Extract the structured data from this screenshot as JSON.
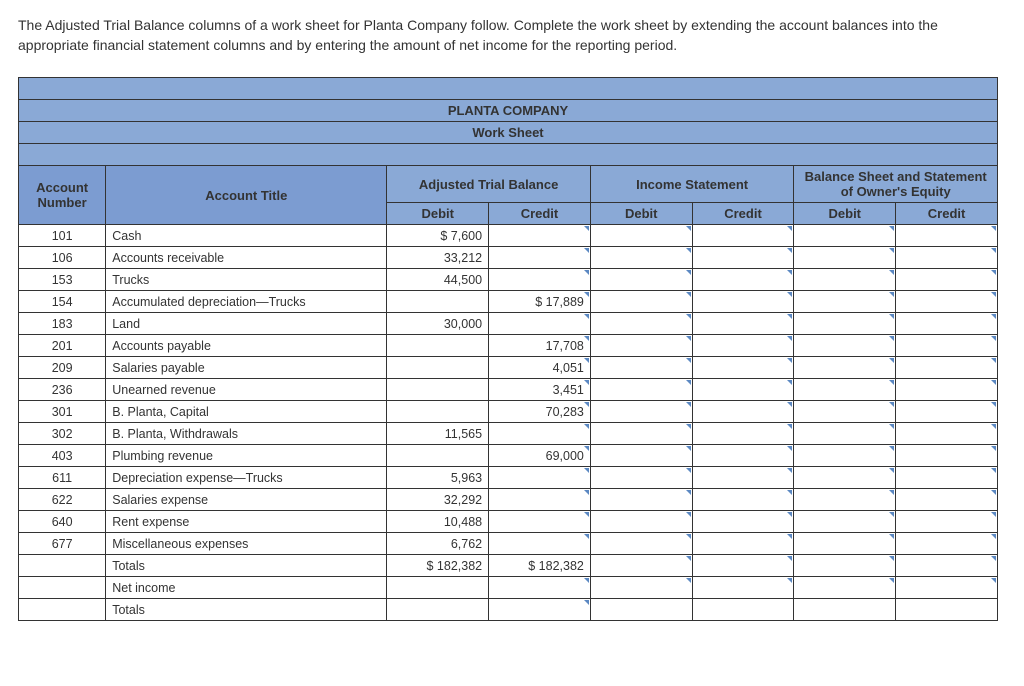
{
  "instructions": "The Adjusted Trial Balance columns of a work sheet for Planta Company follow. Complete the work sheet by extending the account balances into the appropriate financial statement columns and by entering the amount of net income for the reporting period.",
  "company": "PLANTA COMPANY",
  "worksheet_label": "Work Sheet",
  "col_headers": {
    "acct_num": "Account Number",
    "acct_title": "Account Title",
    "atb": "Adjusted Trial Balance",
    "is": "Income Statement",
    "bs": "Balance Sheet and Statement of Owner's Equity",
    "debit": "Debit",
    "credit": "Credit"
  },
  "rows": [
    {
      "num": "101",
      "title": "Cash",
      "atb_debit": "$     7,600",
      "atb_credit": ""
    },
    {
      "num": "106",
      "title": "Accounts receivable",
      "atb_debit": "33,212",
      "atb_credit": ""
    },
    {
      "num": "153",
      "title": "Trucks",
      "atb_debit": "44,500",
      "atb_credit": ""
    },
    {
      "num": "154",
      "title": "Accumulated depreciation—Trucks",
      "atb_debit": "",
      "atb_credit": "$  17,889"
    },
    {
      "num": "183",
      "title": "Land",
      "atb_debit": "30,000",
      "atb_credit": ""
    },
    {
      "num": "201",
      "title": "Accounts payable",
      "atb_debit": "",
      "atb_credit": "17,708"
    },
    {
      "num": "209",
      "title": "Salaries payable",
      "atb_debit": "",
      "atb_credit": "4,051"
    },
    {
      "num": "236",
      "title": "Unearned revenue",
      "atb_debit": "",
      "atb_credit": "3,451"
    },
    {
      "num": "301",
      "title": "B. Planta, Capital",
      "atb_debit": "",
      "atb_credit": "70,283"
    },
    {
      "num": "302",
      "title": "B. Planta, Withdrawals",
      "atb_debit": "11,565",
      "atb_credit": ""
    },
    {
      "num": "403",
      "title": "Plumbing revenue",
      "atb_debit": "",
      "atb_credit": "69,000"
    },
    {
      "num": "611",
      "title": "Depreciation expense—Trucks",
      "atb_debit": "5,963",
      "atb_credit": ""
    },
    {
      "num": "622",
      "title": "Salaries expense",
      "atb_debit": "32,292",
      "atb_credit": ""
    },
    {
      "num": "640",
      "title": "Rent expense",
      "atb_debit": "10,488",
      "atb_credit": ""
    },
    {
      "num": "677",
      "title": "Miscellaneous expenses",
      "atb_debit": "6,762",
      "atb_credit": ""
    }
  ],
  "footer_rows": [
    {
      "title": "Totals",
      "atb_debit": "$ 182,382",
      "atb_credit": "$ 182,382"
    },
    {
      "title": "Net income",
      "atb_debit": "",
      "atb_credit": ""
    },
    {
      "title": "Totals",
      "atb_debit": "",
      "atb_credit": ""
    }
  ],
  "chart_data": {
    "type": "table",
    "company": "Planta Company",
    "statement": "Work Sheet — Adjusted Trial Balance",
    "debits": {
      "101 Cash": 7600,
      "106 Accounts receivable": 33212,
      "153 Trucks": 44500,
      "183 Land": 30000,
      "302 B. Planta, Withdrawals": 11565,
      "611 Depreciation expense—Trucks": 5963,
      "622 Salaries expense": 32292,
      "640 Rent expense": 10488,
      "677 Miscellaneous expenses": 6762
    },
    "credits": {
      "154 Accumulated depreciation—Trucks": 17889,
      "201 Accounts payable": 17708,
      "209 Salaries payable": 4051,
      "236 Unearned revenue": 3451,
      "301 B. Planta, Capital": 70283,
      "403 Plumbing revenue": 69000
    },
    "totals": {
      "debit": 182382,
      "credit": 182382
    }
  }
}
